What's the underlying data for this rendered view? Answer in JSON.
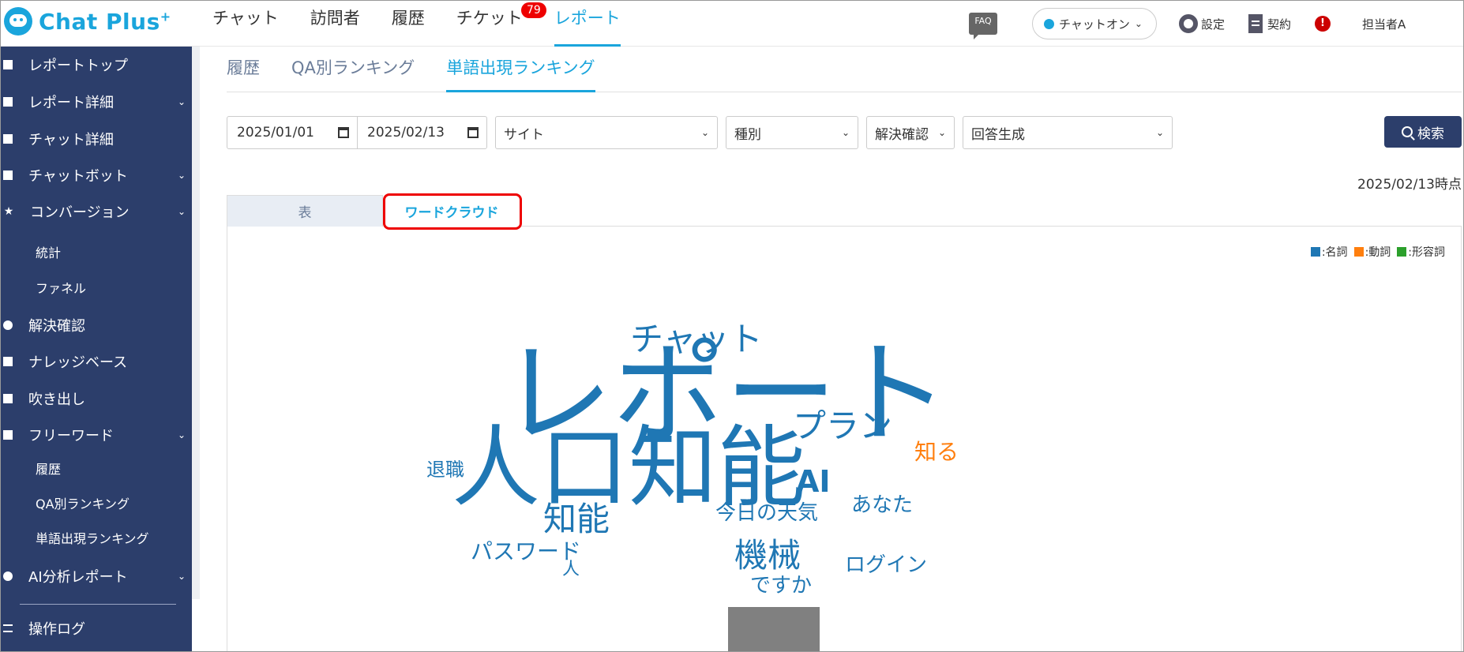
{
  "brand": {
    "name": "Chat Plus",
    "suffix": "+"
  },
  "topnav": {
    "items": [
      {
        "label": "チャット"
      },
      {
        "label": "訪問者"
      },
      {
        "label": "履歴"
      },
      {
        "label": "チケット",
        "badge": "79"
      },
      {
        "label": "レポート",
        "active": true
      }
    ]
  },
  "topright": {
    "faq": "FAQ",
    "status": "チャットオン",
    "settings": "設定",
    "contract": "契約",
    "alert": "!",
    "user": "担当者A"
  },
  "sidebar": {
    "items": [
      {
        "label": "レポートトップ"
      },
      {
        "label": "レポート詳細"
      },
      {
        "label": "チャット詳細"
      },
      {
        "label": "チャットボット"
      },
      {
        "label": "コンバージョン"
      },
      {
        "label": "統計"
      },
      {
        "label": "ファネル"
      },
      {
        "label": "解決確認"
      },
      {
        "label": "ナレッジベース"
      },
      {
        "label": "吹き出し"
      },
      {
        "label": "フリーワード"
      },
      {
        "label": "履歴"
      },
      {
        "label": "QA別ランキング"
      },
      {
        "label": "単語出現ランキング"
      },
      {
        "label": "AI分析レポート"
      },
      {
        "label": "操作ログ"
      }
    ]
  },
  "subtabs": [
    {
      "label": "履歴"
    },
    {
      "label": "QA別ランキング"
    },
    {
      "label": "単語出現ランキング",
      "active": true
    }
  ],
  "filters": {
    "date_from": "2025/01/01",
    "date_to": "2025/02/13",
    "site": "サイト",
    "type": "種別",
    "resolution": "解決確認",
    "answer": "回答生成",
    "search_label": "検索"
  },
  "as_of": "2025/02/13時点",
  "view_tabs": {
    "table": "表",
    "cloud": "ワードクラウド"
  },
  "legend": {
    "noun": {
      "label": ":名詞",
      "color": "#1f77b4"
    },
    "verb": {
      "label": ":動詞",
      "color": "#ff7f0e"
    },
    "adj": {
      "label": ":形容詞",
      "color": "#2ca02c"
    }
  },
  "words": [
    {
      "text": "レポート",
      "pos": "noun"
    },
    {
      "text": "人口知能",
      "pos": "noun"
    },
    {
      "text": "チャット",
      "pos": "noun"
    },
    {
      "text": "プラン",
      "pos": "noun"
    },
    {
      "text": "知る",
      "pos": "verb"
    },
    {
      "text": "AI",
      "pos": "noun"
    },
    {
      "text": "退職",
      "pos": "noun"
    },
    {
      "text": "知能",
      "pos": "noun"
    },
    {
      "text": "今日の天気",
      "pos": "noun"
    },
    {
      "text": "あなた",
      "pos": "noun"
    },
    {
      "text": "パスワード",
      "pos": "noun"
    },
    {
      "text": "人",
      "pos": "noun"
    },
    {
      "text": "機械",
      "pos": "noun"
    },
    {
      "text": "ログイン",
      "pos": "noun"
    },
    {
      "text": "ですか",
      "pos": "noun"
    }
  ]
}
